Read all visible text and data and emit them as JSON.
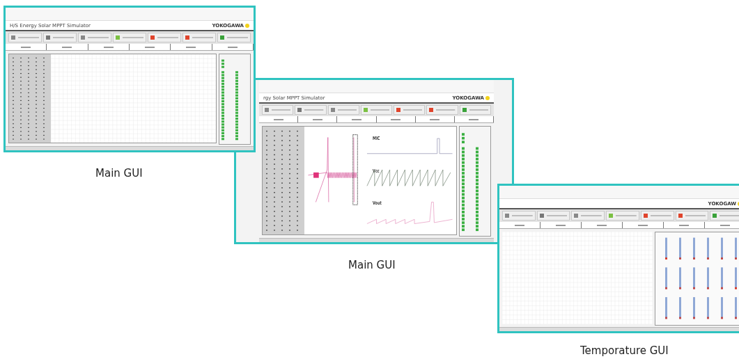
{
  "windows": [
    {
      "kind": "main",
      "title": "H/S Energy Solar MPPT Simulator",
      "brand": "YOKOGAWA",
      "caption": "Main GUI"
    },
    {
      "kind": "main",
      "title": "rgy Solar MPPT Simulator",
      "brand": "YOKOGAWA",
      "wave_labels": [
        "MIC",
        "Vcc",
        "Vout"
      ],
      "caption": "Main GUI"
    },
    {
      "kind": "temperature",
      "brand": "YOKOGAW",
      "caption": "Temporature GUI"
    }
  ]
}
